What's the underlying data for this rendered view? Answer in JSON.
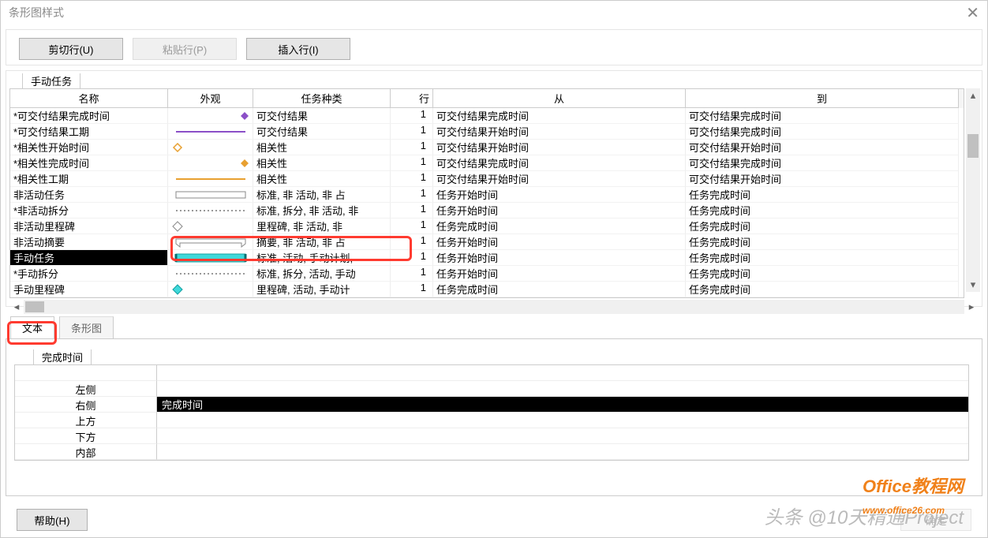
{
  "dialog": {
    "title": "条形图样式"
  },
  "toolbar": {
    "cut_label": "剪切行(U)",
    "paste_label": "粘贴行(P)",
    "insert_label": "插入行(I)"
  },
  "top_tab_label": "手动任务",
  "columns": {
    "name": "名称",
    "appearance": "外观",
    "task_type": "任务种类",
    "row": "行",
    "from": "从",
    "to": "到"
  },
  "rows": [
    {
      "name": "*可交付结果完成时间",
      "shape": "diamond-purple",
      "type": "可交付结果",
      "row": "1",
      "from": "可交付结果完成时间",
      "to": "可交付结果完成时间"
    },
    {
      "name": "*可交付结果工期",
      "shape": "line-purple",
      "type": "可交付结果",
      "row": "1",
      "from": "可交付结果开始时间",
      "to": "可交付结果完成时间"
    },
    {
      "name": "*相关性开始时间",
      "shape": "diamond-orange-open",
      "type": "相关性",
      "row": "1",
      "from": "可交付结果开始时间",
      "to": "可交付结果开始时间"
    },
    {
      "name": "*相关性完成时间",
      "shape": "diamond-orange",
      "type": "相关性",
      "row": "1",
      "from": "可交付结果完成时间",
      "to": "可交付结果完成时间"
    },
    {
      "name": "*相关性工期",
      "shape": "line-orange",
      "type": "相关性",
      "row": "1",
      "from": "可交付结果开始时间",
      "to": "可交付结果开始时间"
    },
    {
      "name": "非活动任务",
      "shape": "bar-hollow",
      "type": "标准, 非  活动, 非  占",
      "row": "1",
      "from": "任务开始时间",
      "to": "任务完成时间"
    },
    {
      "name": "*非活动拆分",
      "shape": "dots",
      "type": "标准, 拆分, 非  活动, 非",
      "row": "1",
      "from": "任务开始时间",
      "to": "任务完成时间"
    },
    {
      "name": "非活动里程碑",
      "shape": "diamond-hollow",
      "type": "里程碑, 非  活动, 非",
      "row": "1",
      "from": "任务完成时间",
      "to": "任务完成时间"
    },
    {
      "name": "非活动摘要",
      "shape": "summary-hollow",
      "type": "摘要, 非  活动, 非  占",
      "row": "1",
      "from": "任务开始时间",
      "to": "任务完成时间"
    },
    {
      "name": "手动任务",
      "shape": "bar-cyan",
      "type": "标准, 活动, 手动计划,",
      "row": "1",
      "from": "任务开始时间",
      "to": "任务完成时间",
      "selected": true
    },
    {
      "name": "*手动拆分",
      "shape": "dots",
      "type": "标准, 拆分, 活动, 手动",
      "row": "1",
      "from": "任务开始时间",
      "to": "任务完成时间"
    },
    {
      "name": "手动里程碑",
      "shape": "diamond-cyan",
      "type": "里程碑, 活动, 手动计",
      "row": "1",
      "from": "任务完成时间",
      "to": "任务完成时间"
    }
  ],
  "tabs2": {
    "text": "文本",
    "bar": "条形图"
  },
  "panel2_header": "完成时间",
  "text_positions": {
    "left": {
      "label": "左侧",
      "value": ""
    },
    "right": {
      "label": "右侧",
      "value": "完成时间"
    },
    "top": {
      "label": "上方",
      "value": ""
    },
    "bottom": {
      "label": "下方",
      "value": ""
    },
    "inside": {
      "label": "内部",
      "value": ""
    }
  },
  "footer": {
    "help": "帮助(H)",
    "ok": "确定"
  },
  "watermark": "头条 @10天精通Project",
  "watermark2": "Office教程网",
  "watermark3": "www.office26.com"
}
